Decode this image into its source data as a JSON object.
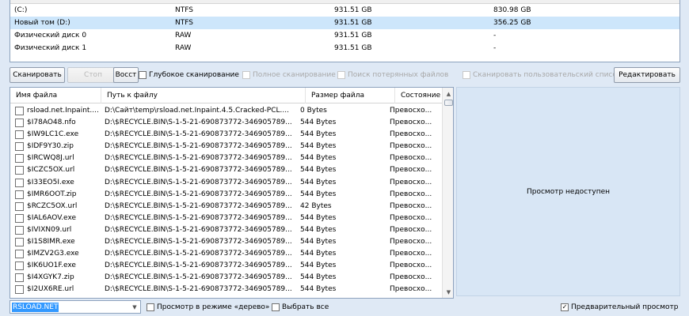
{
  "disks": [
    {
      "name": "(C:)",
      "fs": "NTFS",
      "size": "931.51 GB",
      "free": "830.98 GB",
      "selected": false
    },
    {
      "name": "Новый том (D:)",
      "fs": "NTFS",
      "size": "931.51 GB",
      "free": "356.25 GB",
      "selected": true
    },
    {
      "name": "Физический диск 0",
      "fs": "RAW",
      "size": "931.51 GB",
      "free": "-",
      "selected": false
    },
    {
      "name": "Физический диск 1",
      "fs": "RAW",
      "size": "931.51 GB",
      "free": "-",
      "selected": false
    }
  ],
  "toolbar": {
    "scan_label": "Сканировать",
    "stop_label": "Стоп",
    "restore_label": "Восст",
    "deep_scan_label": "Глубокое сканирование",
    "full_scan_label": "Полное сканирование",
    "lost_files_label": "Поиск потерянных файлов",
    "custom_list_label": "Сканировать пользовательский список",
    "edit_label": "Редактировать"
  },
  "filelist": {
    "columns": [
      "Имя файла",
      "Путь к файлу",
      "Размер файла",
      "Состояние"
    ],
    "rows": [
      [
        "rsload.net.Inpaint....",
        "D:\\Сайт\\temp\\rsload.net.Inpaint.4.5.Cracked-PCL....",
        "0 Bytes",
        "Превосхо..."
      ],
      [
        "$I78AO48.nfo",
        "D:\\$RECYCLE.BIN\\S-1-5-21-690873772-346905789...",
        "544 Bytes",
        "Превосхо..."
      ],
      [
        "$IW9LC1C.exe",
        "D:\\$RECYCLE.BIN\\S-1-5-21-690873772-346905789...",
        "544 Bytes",
        "Превосхо..."
      ],
      [
        "$IDF9Y30.zip",
        "D:\\$RECYCLE.BIN\\S-1-5-21-690873772-346905789...",
        "544 Bytes",
        "Превосхо..."
      ],
      [
        "$IRCWQ8J.url",
        "D:\\$RECYCLE.BIN\\S-1-5-21-690873772-346905789...",
        "544 Bytes",
        "Превосхо..."
      ],
      [
        "$ICZC5OX.url",
        "D:\\$RECYCLE.BIN\\S-1-5-21-690873772-346905789...",
        "544 Bytes",
        "Превосхо..."
      ],
      [
        "$I33EO5I.exe",
        "D:\\$RECYCLE.BIN\\S-1-5-21-690873772-346905789...",
        "544 Bytes",
        "Превосхо..."
      ],
      [
        "$IMR6OOT.zip",
        "D:\\$RECYCLE.BIN\\S-1-5-21-690873772-346905789...",
        "544 Bytes",
        "Превосхо..."
      ],
      [
        "$RCZC5OX.url",
        "D:\\$RECYCLE.BIN\\S-1-5-21-690873772-346905789...",
        "42 Bytes",
        "Превосхо..."
      ],
      [
        "$IAL6AOV.exe",
        "D:\\$RECYCLE.BIN\\S-1-5-21-690873772-346905789...",
        "544 Bytes",
        "Превосхо..."
      ],
      [
        "$IVIXN09.url",
        "D:\\$RECYCLE.BIN\\S-1-5-21-690873772-346905789...",
        "544 Bytes",
        "Превосхо..."
      ],
      [
        "$I1S8IMR.exe",
        "D:\\$RECYCLE.BIN\\S-1-5-21-690873772-346905789...",
        "544 Bytes",
        "Превосхо..."
      ],
      [
        "$IMZV2G3.exe",
        "D:\\$RECYCLE.BIN\\S-1-5-21-690873772-346905789...",
        "544 Bytes",
        "Превосхо..."
      ],
      [
        "$IK6UO1F.exe",
        "D:\\$RECYCLE.BIN\\S-1-5-21-690873772-346905789...",
        "544 Bytes",
        "Превосхо..."
      ],
      [
        "$I4XGYK7.zip",
        "D:\\$RECYCLE.BIN\\S-1-5-21-690873772-346905789...",
        "544 Bytes",
        "Превосхо..."
      ],
      [
        "$I2UX6RE.url",
        "D:\\$RECYCLE.BIN\\S-1-5-21-690873772-346905789...",
        "544 Bytes",
        "Превосхо..."
      ]
    ]
  },
  "preview": {
    "unavailable_label": "Просмотр недоступен"
  },
  "bottom": {
    "combo_value": "RSLOAD.NET",
    "tree_view_label": "Просмотр в режиме «дерево»",
    "select_all_label": "Выбрать все",
    "preview_label": "Предварительный просмотр",
    "preview_checked": true
  },
  "icons": {
    "checkmark": "✓",
    "scroll_up": "▲",
    "scroll_down": "▼",
    "dropdown": "▼"
  }
}
